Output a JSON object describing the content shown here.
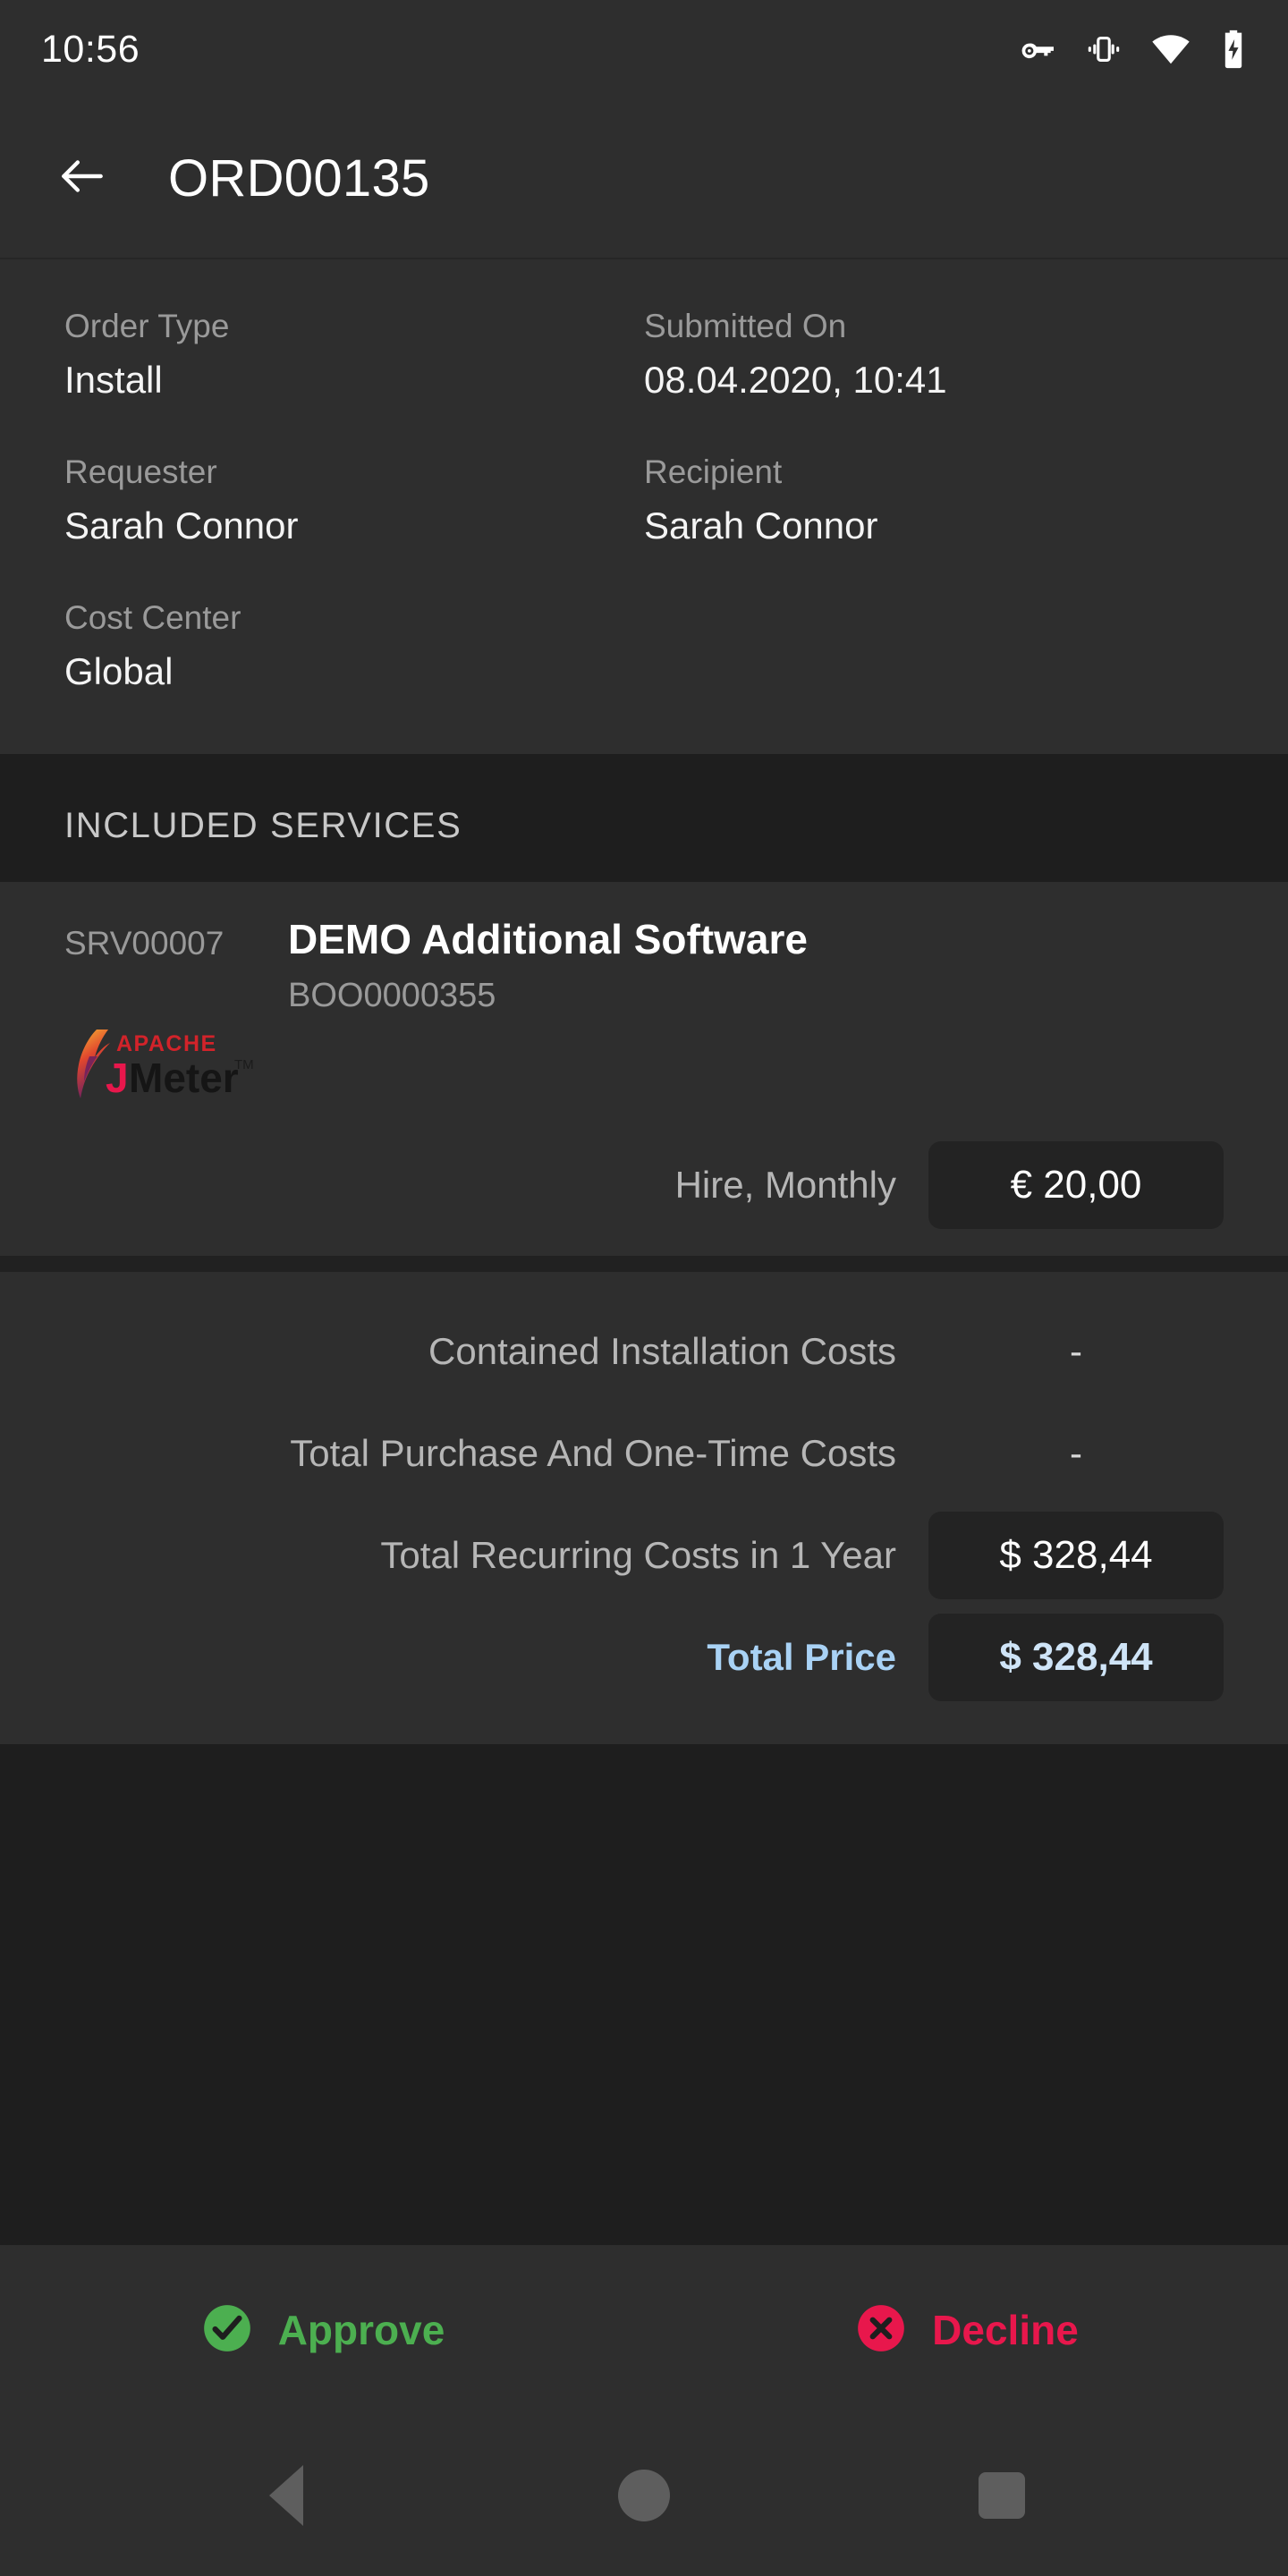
{
  "status_bar": {
    "time": "10:56",
    "icons": [
      "vpn-key-icon",
      "vibrate-icon",
      "wifi-icon",
      "battery-charging-icon"
    ]
  },
  "app_bar": {
    "back_icon": "arrow-left-icon",
    "title": "ORD00135"
  },
  "details": {
    "rows": [
      [
        {
          "label": "Order Type",
          "value": "Install"
        },
        {
          "label": "Submitted On",
          "value": "08.04.2020, 10:41"
        }
      ],
      [
        {
          "label": "Requester",
          "value": "Sarah Connor"
        },
        {
          "label": "Recipient",
          "value": "Sarah Connor"
        }
      ],
      [
        {
          "label": "Cost Center",
          "value": "Global"
        }
      ]
    ]
  },
  "services_section": {
    "title": "INCLUDED SERVICES",
    "item": {
      "code": "SRV00007",
      "name": "DEMO Additional Software",
      "booking_id": "BOO0000355",
      "logo_alt": "apache-jmeter-logo",
      "logo_text_top": "APACHE",
      "logo_text_j": "J",
      "logo_text_meter": "Meter",
      "logo_tm": "TM",
      "price_label": "Hire, Monthly",
      "price_value": "€ 20,00"
    }
  },
  "summary": {
    "rows": [
      {
        "label": "Contained Installation Costs",
        "value": "-",
        "chip": false,
        "accent": false
      },
      {
        "label": "Total Purchase And One-Time Costs",
        "value": "-",
        "chip": false,
        "accent": false
      },
      {
        "label": "Total Recurring Costs in 1 Year",
        "value": "$ 328,44",
        "chip": true,
        "accent": false
      },
      {
        "label": "Total Price",
        "value": "$ 328,44",
        "chip": true,
        "accent": true
      }
    ]
  },
  "actions": {
    "approve": {
      "label": "Approve",
      "icon": "check-circle-icon",
      "color": "#4caf50"
    },
    "decline": {
      "label": "Decline",
      "icon": "x-circle-icon",
      "color": "#e8174c"
    }
  },
  "nav_bar": {
    "back": "nav-back-icon",
    "home": "nav-home-icon",
    "recents": "nav-recents-icon"
  },
  "colors": {
    "page_bg": "#1e1e1e",
    "panel_bg": "#2e2e2e",
    "chip_bg": "#232323",
    "label": "#9a9a9a",
    "value": "#f4f4f4",
    "accent_blue": "#a9d2f5"
  }
}
